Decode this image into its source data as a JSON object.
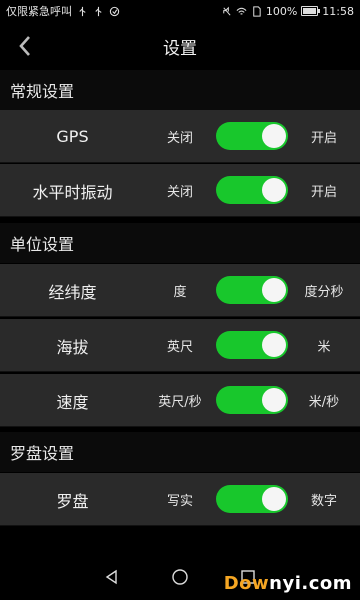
{
  "status_bar": {
    "carrier_text": "仅限紧急呼叫",
    "battery": "100%",
    "time": "11:58"
  },
  "header": {
    "title": "设置"
  },
  "sections": [
    {
      "title": "常规设置",
      "items": [
        {
          "label": "GPS",
          "off_label": "关闭",
          "on_label": "开启",
          "enabled": true
        },
        {
          "label": "水平时振动",
          "off_label": "关闭",
          "on_label": "开启",
          "enabled": true
        }
      ]
    },
    {
      "title": "单位设置",
      "items": [
        {
          "label": "经纬度",
          "off_label": "度",
          "on_label": "度分秒",
          "enabled": true
        },
        {
          "label": "海拔",
          "off_label": "英尺",
          "on_label": "米",
          "enabled": true
        },
        {
          "label": "速度",
          "off_label": "英尺/秒",
          "on_label": "米/秒",
          "enabled": true
        }
      ]
    },
    {
      "title": "罗盘设置",
      "items": [
        {
          "label": "罗盘",
          "off_label": "写实",
          "on_label": "数字",
          "enabled": true
        }
      ]
    }
  ],
  "nav_bar": {
    "back_icon": "triangle-left",
    "home_icon": "circle",
    "recents_icon": "square"
  },
  "watermark": {
    "text_a": "Dow",
    "text_b": "nyi.com"
  },
  "colors": {
    "switch_on": "#18c72c",
    "row_bg": "#2a2a2a",
    "section_bg": "#0b0b0b"
  }
}
